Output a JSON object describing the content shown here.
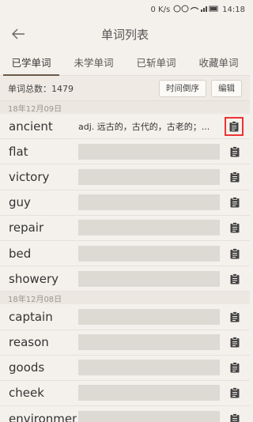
{
  "status": {
    "network": "0 K/s",
    "time": "14:18",
    "battery": "100"
  },
  "header": {
    "title": "单词列表"
  },
  "tabs": [
    {
      "label": "已学单词",
      "active": true
    },
    {
      "label": "未学单词",
      "active": false
    },
    {
      "label": "已斩单词",
      "active": false
    },
    {
      "label": "收藏单词",
      "active": false
    }
  ],
  "summary": {
    "count_label": "单词总数：1479",
    "sort_label": "时间倒序",
    "edit_label": "编辑"
  },
  "groups": [
    {
      "date": "18年12月09日",
      "words": [
        {
          "word": "ancient",
          "meaning": "adj. 远古的，古代的，古老的；...",
          "shown": true
        },
        {
          "word": "flat",
          "meaning": "",
          "shown": false
        },
        {
          "word": "victory",
          "meaning": "",
          "shown": false
        },
        {
          "word": "guy",
          "meaning": "",
          "shown": false
        },
        {
          "word": "repair",
          "meaning": "",
          "shown": false
        },
        {
          "word": "bed",
          "meaning": "",
          "shown": false
        },
        {
          "word": "showery",
          "meaning": "",
          "shown": false
        }
      ]
    },
    {
      "date": "18年12月08日",
      "words": [
        {
          "word": "captain",
          "meaning": "",
          "shown": false
        },
        {
          "word": "reason",
          "meaning": "",
          "shown": false
        },
        {
          "word": "goods",
          "meaning": "",
          "shown": false
        },
        {
          "word": "cheek",
          "meaning": "",
          "shown": false
        },
        {
          "word": "environmental",
          "meaning": "",
          "shown": false
        }
      ]
    }
  ],
  "colors": {
    "background": "#f4f1ec",
    "tab_indicator": "#6b5a4a",
    "highlight": "#e33333",
    "mask": "#ddd9d3"
  }
}
